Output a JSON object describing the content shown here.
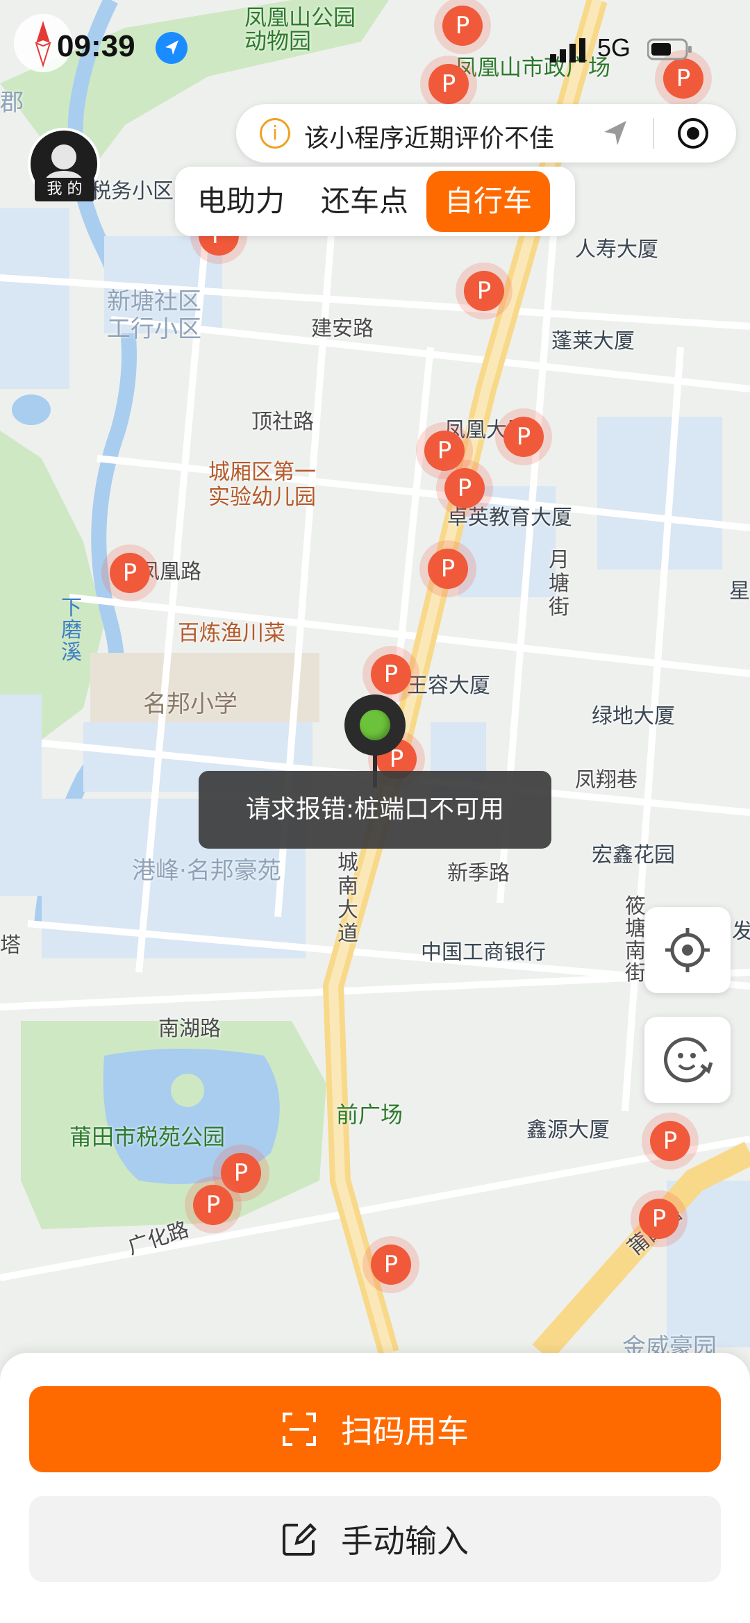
{
  "status_bar": {
    "time": "09:39",
    "network": "5G",
    "icons": [
      "compass-icon",
      "location-arrow-icon",
      "signal-icon",
      "battery-icon"
    ]
  },
  "notice": {
    "text": "该小程序近期评价不佳",
    "icons": [
      "info-icon",
      "navigation-icon",
      "target-icon"
    ]
  },
  "user": {
    "label": "我 的"
  },
  "tabs": [
    {
      "label": "电助力",
      "active": false
    },
    {
      "label": "还车点",
      "active": false
    },
    {
      "label": "自行车",
      "active": true
    }
  ],
  "toast": {
    "text": "请求报错:桩端口不可用"
  },
  "map": {
    "labels": {
      "zoo": "凤凰山公园\n动物园",
      "fenghuang_square": "凤凰山市政广场",
      "shuiwu": "税务小区",
      "renshou": "人寿大厦",
      "xintang": "新塘社区\n工行小区",
      "jianan": "建安路",
      "penglai": "蓬莱大厦",
      "dingshe": "顶社路",
      "fenghuang_tower": "凤凰大厦",
      "kindergarten": "城厢区第一\n实验幼儿园",
      "zhuoying": "卓英教育大厦",
      "fenghuang_road": "凤凰路",
      "yuetang": "月塘街",
      "xiatangxi": "下磨溪",
      "restaurant": "百炼渔川菜",
      "xingfa": "星",
      "wangrong": "王容大厦",
      "mingbang_school": "名邦小学",
      "lvdi": "绿地大厦",
      "fengxiang": "凤翔巷",
      "chengnan": "城南大道",
      "gangfeng": "港峰·名邦豪苑",
      "xinji": "新季路",
      "hongxin": "宏鑫花园",
      "icbc": "中国工商银行",
      "shaotang": "筱塘南街",
      "nanhu": "南湖路",
      "qianguangchang": "前广场",
      "shuiyuan_park": "莆田市税苑公园",
      "xinyuan": "鑫源大厦",
      "guanghua": "广化路",
      "putian_road": "莆田路",
      "jinwei": "金威豪园",
      "fa": "发",
      "jun": "郡",
      "ta": "塔"
    },
    "parking_marker_label": "P",
    "colors": {
      "road_main": "#f8d98a",
      "water": "#a9cdef",
      "park": "#cfe8c4",
      "block": "#d9e6f3"
    }
  },
  "controls": {
    "locate": "locate-icon",
    "feedback": "feedback-icon"
  },
  "actions": {
    "scan_label": "扫码用车",
    "manual_label": "手动输入"
  },
  "accent": "#ff6a00"
}
